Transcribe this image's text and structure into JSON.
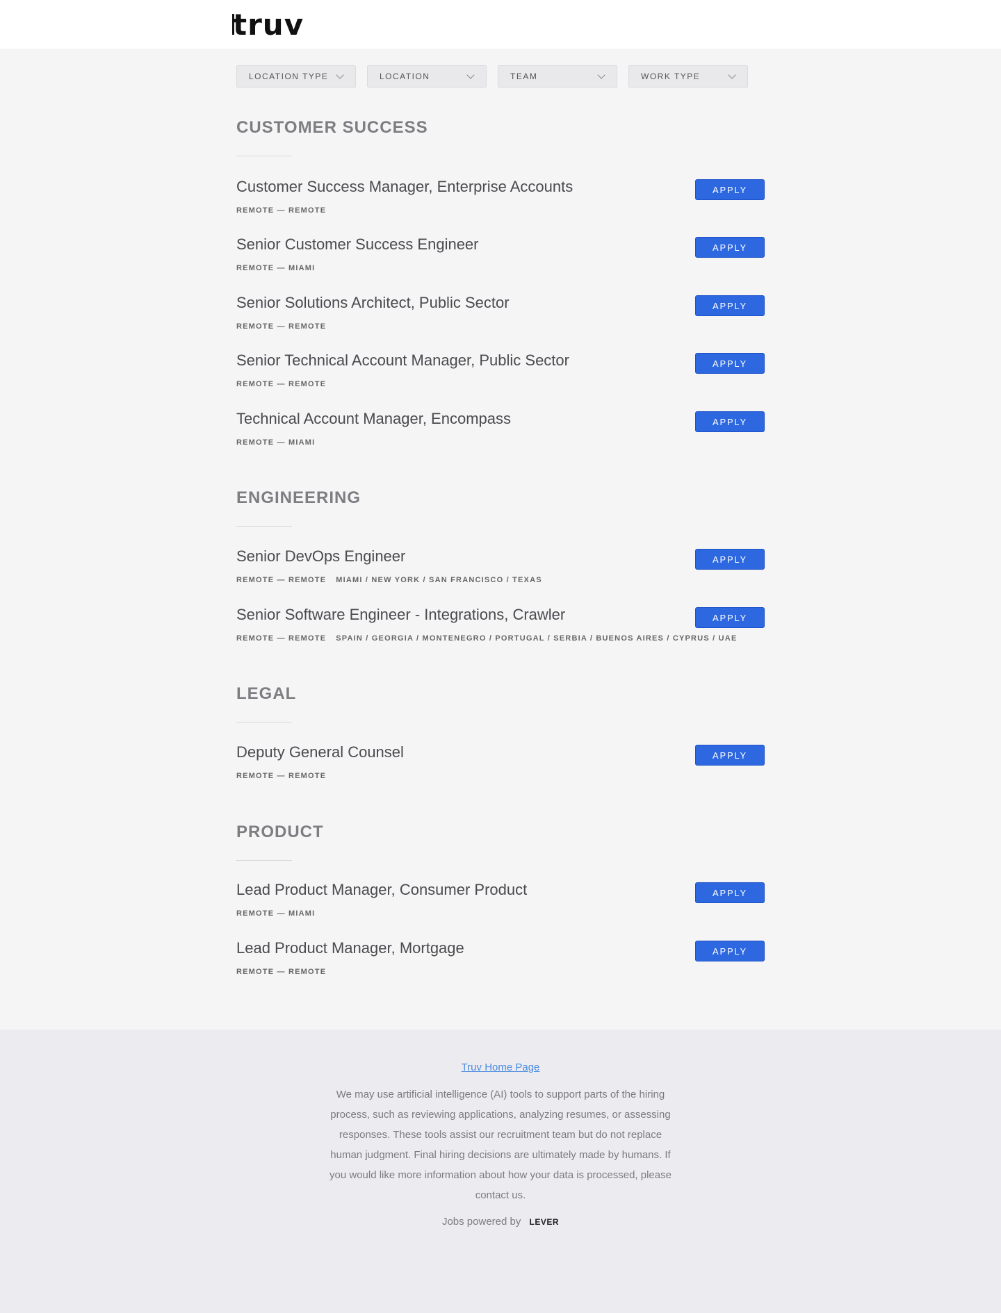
{
  "header": {
    "logo_text": "truv"
  },
  "filters": [
    {
      "label": "LOCATION TYPE"
    },
    {
      "label": "LOCATION"
    },
    {
      "label": "TEAM"
    },
    {
      "label": "WORK TYPE"
    }
  ],
  "groups": [
    {
      "title": "CUSTOMER SUCCESS",
      "postings": [
        {
          "title": "Customer Success Manager, Enterprise Accounts",
          "meta": "REMOTE — REMOTE",
          "extra": "",
          "apply": "APPLY"
        },
        {
          "title": "Senior Customer Success Engineer",
          "meta": "REMOTE — MIAMI",
          "extra": "",
          "apply": "APPLY"
        },
        {
          "title": "Senior Solutions Architect, Public Sector",
          "meta": "REMOTE — REMOTE",
          "extra": "",
          "apply": "APPLY"
        },
        {
          "title": "Senior Technical Account Manager, Public Sector",
          "meta": "REMOTE — REMOTE",
          "extra": "",
          "apply": "APPLY"
        },
        {
          "title": "Technical Account Manager, Encompass",
          "meta": "REMOTE — MIAMI",
          "extra": "",
          "apply": "APPLY"
        }
      ]
    },
    {
      "title": "ENGINEERING",
      "postings": [
        {
          "title": "Senior DevOps Engineer",
          "meta": "REMOTE — REMOTE",
          "extra": "MIAMI / NEW YORK / SAN FRANCISCO / TEXAS",
          "apply": "APPLY"
        },
        {
          "title": "Senior Software Engineer - Integrations, Crawler",
          "meta": "REMOTE — REMOTE",
          "extra": "SPAIN / GEORGIA / MONTENEGRO / PORTUGAL / SERBIA / BUENOS AIRES / CYPRUS / UAE",
          "apply": "APPLY"
        }
      ]
    },
    {
      "title": "LEGAL",
      "postings": [
        {
          "title": "Deputy General Counsel",
          "meta": "REMOTE — REMOTE",
          "extra": "",
          "apply": "APPLY"
        }
      ]
    },
    {
      "title": "PRODUCT",
      "postings": [
        {
          "title": "Lead Product Manager, Consumer Product",
          "meta": "REMOTE — MIAMI",
          "extra": "",
          "apply": "APPLY"
        },
        {
          "title": "Lead Product Manager, Mortgage",
          "meta": "REMOTE — REMOTE",
          "extra": "",
          "apply": "APPLY"
        }
      ]
    }
  ],
  "footer": {
    "home_link": "Truv Home Page",
    "notice": "We may use artificial intelligence (AI) tools to support parts of the hiring process, such as reviewing applications, analyzing resumes, or assessing responses. These tools assist our recruitment team but do not replace human judgment. Final hiring decisions are ultimately made by humans. If you would like more information about how your data is processed, please contact us.",
    "powered_text": "Jobs powered by",
    "powered_brand": "LEVER"
  }
}
